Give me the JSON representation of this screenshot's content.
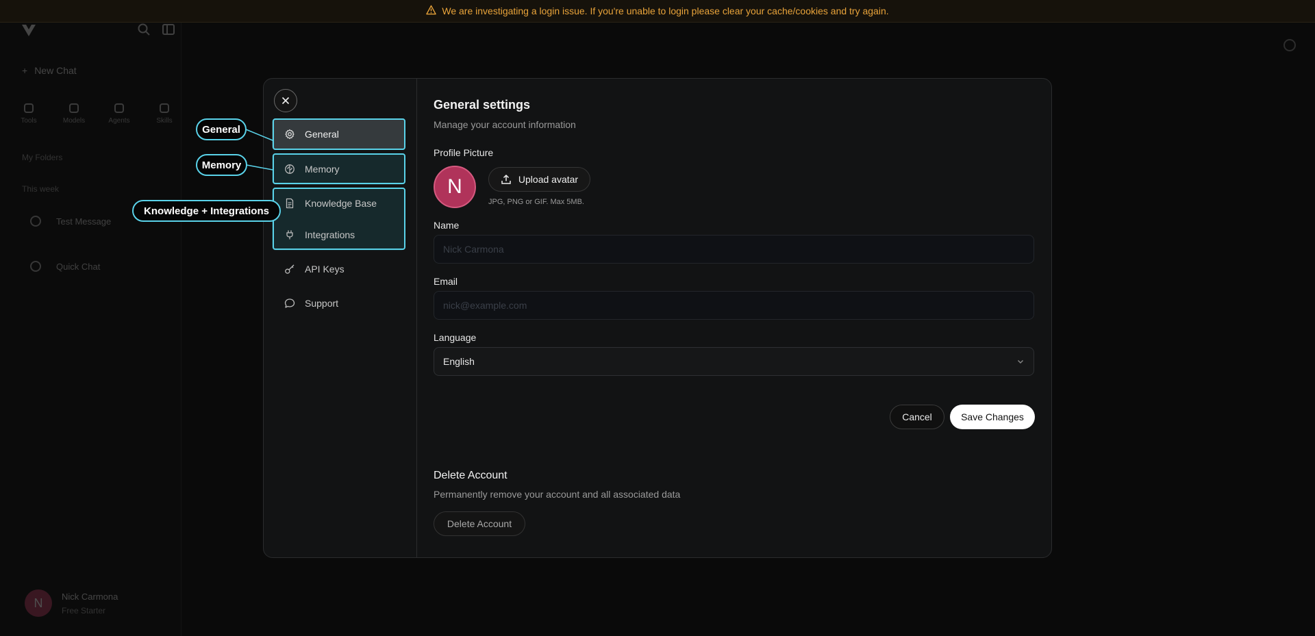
{
  "banner": {
    "message": "We are investigating a login issue. If you're unable to login please clear your cache/cookies and try again."
  },
  "background": {
    "new_chat_label": "New Chat",
    "quick_actions": [
      "Tools",
      "Models",
      "Agents",
      "Skills"
    ],
    "section_folders": "My Folders",
    "section_history": "This week",
    "chats": [
      "Test Message",
      "Quick Chat"
    ],
    "user_initial": "N",
    "user_name": "Nick Carmona",
    "user_plan": "Free Starter"
  },
  "modal": {
    "nav": [
      {
        "label": "General",
        "icon": "gear-icon"
      },
      {
        "label": "Memory",
        "icon": "brain-icon"
      },
      {
        "label": "Knowledge Base",
        "icon": "document-icon"
      },
      {
        "label": "Integrations",
        "icon": "plug-icon"
      },
      {
        "label": "API Keys",
        "icon": "key-icon"
      },
      {
        "label": "Support",
        "icon": "chat-bubble-icon"
      }
    ],
    "title": "General settings",
    "subtitle": "Manage your account information",
    "profile_picture_label": "Profile Picture",
    "avatar_initial": "N",
    "upload_label": "Upload avatar",
    "upload_hint": "JPG, PNG or GIF. Max 5MB.",
    "name_label": "Name",
    "name_value": "Nick Carmona",
    "email_label": "Email",
    "email_value": "nick@example.com",
    "language_label": "Language",
    "language_value": "English",
    "cancel_label": "Cancel",
    "save_label": "Save Changes",
    "delete_title": "Delete Account",
    "delete_subtitle": "Permanently remove your account and all associated data",
    "delete_button": "Delete Account"
  },
  "callouts": {
    "general": "General",
    "memory": "Memory",
    "knowledge": "Knowledge + Integrations"
  },
  "colors": {
    "accent": "#5ad3ea",
    "banner_text": "#e8a33a",
    "avatar": "#b0335a"
  }
}
